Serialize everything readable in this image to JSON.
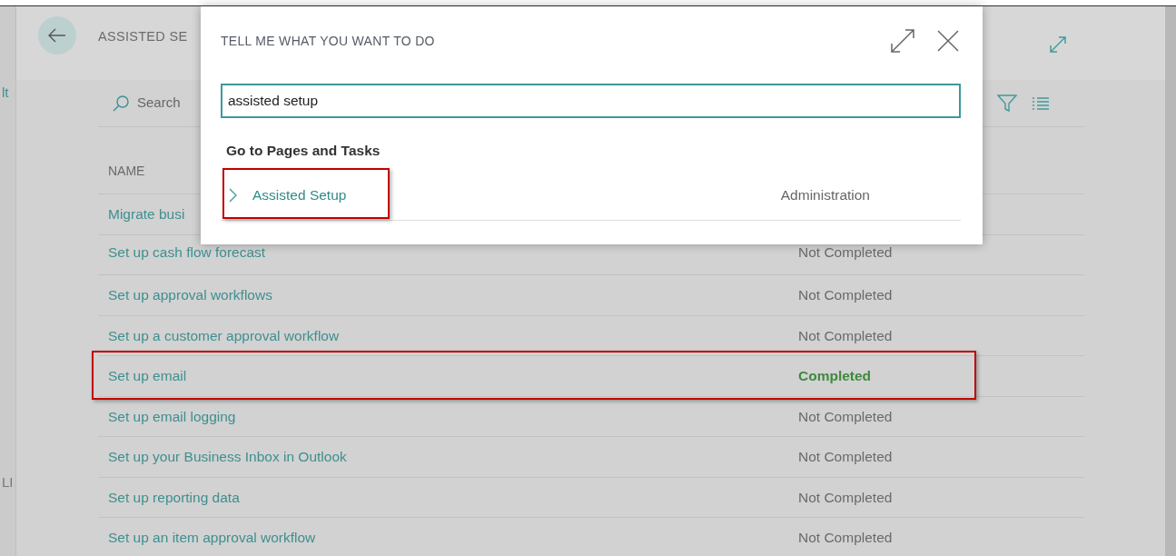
{
  "edge_texts": [
    "lt",
    "LI"
  ],
  "page": {
    "title": "ASSISTED SE",
    "search_label": "Search",
    "columns": [
      "NAME"
    ],
    "rows": [
      {
        "name": "Migrate busi",
        "highlighted": false
      },
      {
        "name": "Set up cash flow forecast",
        "status": "Not Completed",
        "completed": false,
        "highlighted": false
      },
      {
        "name": "Set up approval workflows",
        "status": "Not Completed",
        "completed": false,
        "highlighted": false
      },
      {
        "name": "Set up a customer approval workflow",
        "status": "Not Completed",
        "completed": false,
        "highlighted": false
      },
      {
        "name": "Set up email",
        "status": "Completed",
        "completed": true,
        "highlighted": true
      },
      {
        "name": "Set up email logging",
        "status": "Not Completed",
        "completed": false,
        "highlighted": false
      },
      {
        "name": "Set up your Business Inbox in Outlook",
        "status": "Not Completed",
        "completed": false,
        "highlighted": false
      },
      {
        "name": "Set up reporting data",
        "status": "Not Completed",
        "completed": false,
        "highlighted": false
      },
      {
        "name": "Set up an item approval workflow",
        "status": "Not Completed",
        "completed": false,
        "highlighted": false
      }
    ]
  },
  "dialog": {
    "title": "TELL ME WHAT YOU WANT TO DO",
    "search": {
      "value": "assisted setup"
    },
    "section": "Go to Pages and Tasks",
    "results": [
      {
        "label": "Assisted Setup",
        "category": "Administration",
        "highlighted": true
      }
    ]
  }
}
